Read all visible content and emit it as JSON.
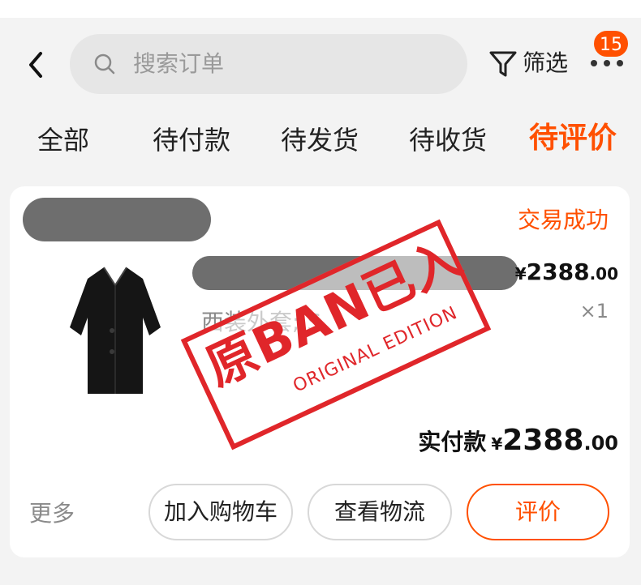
{
  "header": {
    "search_placeholder": "搜索订单",
    "filter_label": "筛选",
    "notification_count": "15"
  },
  "tabs": [
    {
      "label": "全部"
    },
    {
      "label": "待付款"
    },
    {
      "label": "待发货"
    },
    {
      "label": "待收货"
    },
    {
      "label": "待评价"
    }
  ],
  "active_tab": "待评价",
  "order": {
    "status": "交易成功",
    "price_symbol": "¥",
    "price_int": "2388",
    "price_dec": ".00",
    "sku": "西装外套; S",
    "qty": "×1",
    "paid_label": "实付款",
    "paid_symbol": "¥",
    "paid_int": "2388",
    "paid_dec": ".00",
    "more_label": "更多",
    "buttons": {
      "add_to_cart": "加入购物车",
      "view_logistics": "查看物流",
      "review": "评价"
    }
  },
  "stamp": {
    "main": "原BAN已入",
    "sub": "ORIGINAL EDITION"
  },
  "colors": {
    "accent": "#ff5000",
    "stamp": "#e0262a",
    "background": "#f3f3f3"
  }
}
